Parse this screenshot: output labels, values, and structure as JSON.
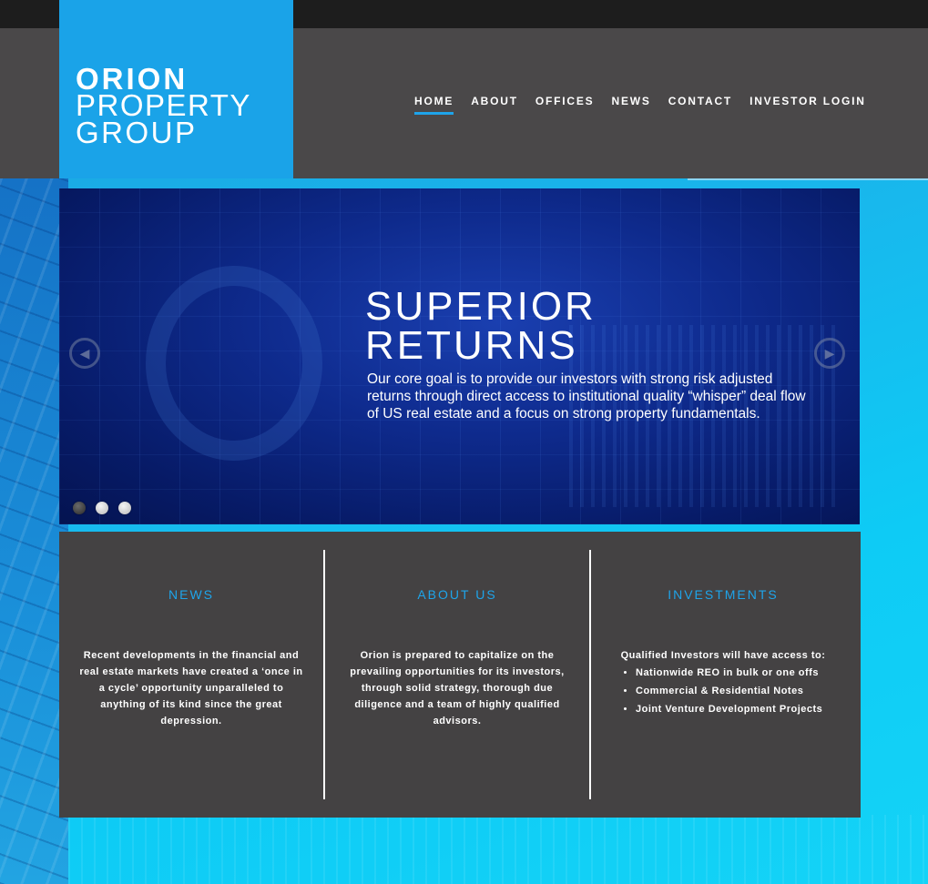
{
  "brand": {
    "line1": "ORION",
    "line2": "PROPERTY",
    "line3": "GROUP",
    "logo_color": "#1aa3e8"
  },
  "nav": {
    "items": [
      {
        "label": "HOME",
        "active": true
      },
      {
        "label": "ABOUT"
      },
      {
        "label": "OFFICES"
      },
      {
        "label": "NEWS"
      },
      {
        "label": "CONTACT"
      },
      {
        "label": "INVESTOR LOGIN"
      }
    ]
  },
  "slider": {
    "title_line1": "SUPERIOR",
    "title_line2": "RETURNS",
    "text": "Our core goal is to provide our investors with strong risk adjusted returns through direct access to institutional quality “whisper” deal flow of US real estate and a focus on strong property fundamentals.",
    "prev_icon": "chevron-left-icon",
    "next_icon": "chevron-right-icon",
    "slide_count": 3,
    "active_slide": 1
  },
  "columns": {
    "news": {
      "title": "NEWS",
      "text": "Recent developments in the financial and real estate markets have created a ‘once in a cycle’ opportunity unparalleled to anything of its kind since the great depression."
    },
    "about": {
      "title": "ABOUT US",
      "text": "Orion is prepared to capitalize on the prevailing opportunities for its investors, through solid strategy, thorough due diligence and a team of highly qualified advisors."
    },
    "investments": {
      "title": "INVESTMENTS",
      "intro": "Qualified Investors will have access to:",
      "items": [
        "Nationwide REO in bulk or one offs",
        "Commercial & Residential Notes",
        "Joint Venture Development Projects"
      ]
    }
  },
  "colors": {
    "accent": "#1ea4ea",
    "header_bg": "#4a4849",
    "panel_bg": "#444243"
  }
}
